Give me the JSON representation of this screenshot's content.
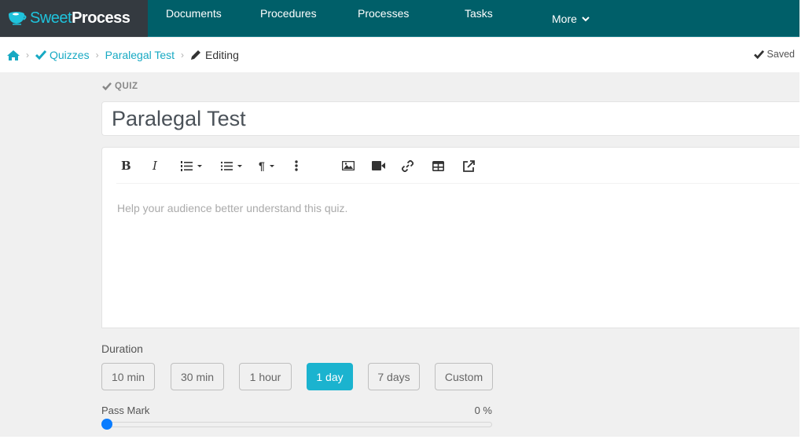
{
  "nav": {
    "brand_sweet": "Sweet",
    "brand_process": "Process",
    "items": [
      {
        "label": "Documents"
      },
      {
        "label": "Procedures"
      },
      {
        "label": "Processes"
      },
      {
        "label": "Tasks"
      },
      {
        "label": "More"
      }
    ],
    "more_icon": "chevron-down-icon"
  },
  "breadcrumb": {
    "home_icon": "home-icon",
    "items": [
      {
        "label": "Quizzes",
        "icon": "check-icon"
      },
      {
        "label": "Paralegal Test"
      }
    ],
    "current": {
      "label": "Editing",
      "icon": "pencil-icon"
    },
    "status": "Saved"
  },
  "quiz": {
    "section_label": "QUIZ",
    "title_value": "Paralegal Test",
    "editor": {
      "toolbar": [
        "bold",
        "italic",
        "ordered-list",
        "unordered-list",
        "paragraph",
        "more-options",
        "image",
        "video",
        "link",
        "table",
        "external-link"
      ],
      "placeholder": "Help your audience better understand this quiz."
    }
  },
  "duration": {
    "label": "Duration",
    "options": [
      {
        "label": "10 min",
        "selected": false
      },
      {
        "label": "30 min",
        "selected": false
      },
      {
        "label": "1 hour",
        "selected": false
      },
      {
        "label": "1 day",
        "selected": true
      },
      {
        "label": "7 days",
        "selected": false
      },
      {
        "label": "Custom",
        "selected": false
      }
    ]
  },
  "pass_mark": {
    "label": "Pass Mark",
    "value_text": "0 %",
    "value_percent": 0
  },
  "colors": {
    "nav_bg": "#005f69",
    "brand_bg": "#343a40",
    "accent": "#1bb3cf",
    "link": "#17a9c3",
    "slider_thumb": "#0a7cff"
  }
}
